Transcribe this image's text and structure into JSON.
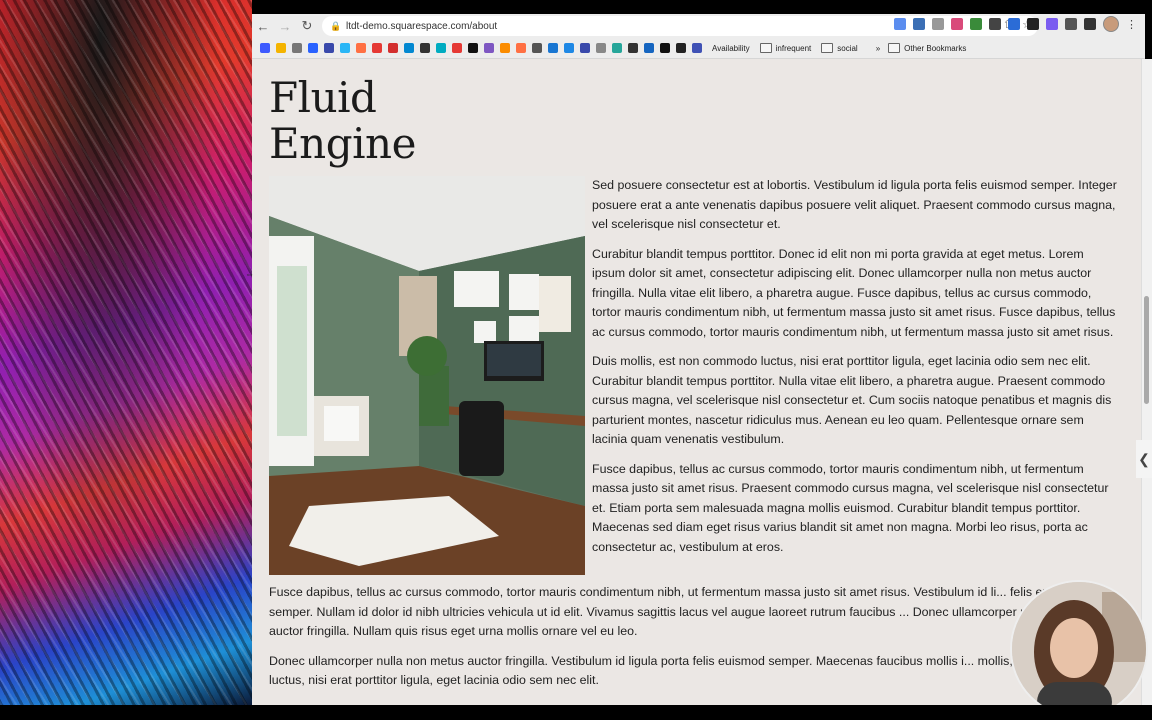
{
  "browser": {
    "url": "ltdt-demo.squarespace.com/about",
    "bookmarks": [
      {
        "label": "Availability"
      },
      {
        "label": "infrequent"
      },
      {
        "label": "social"
      },
      {
        "label": "Other Bookmarks"
      }
    ],
    "more_bookmarks": "»"
  },
  "page": {
    "heading_line1": "Fluid",
    "heading_line2": "Engine",
    "column_paragraphs": [
      "Sed posuere consectetur est at lobortis. Vestibulum id ligula porta felis euismod semper. Integer posuere erat a ante venenatis dapibus posuere velit aliquet. Praesent commodo cursus magna, vel scelerisque nisl consectetur et.",
      "Curabitur blandit tempus porttitor. Donec id elit non mi porta gravida at eget metus. Lorem ipsum dolor sit amet, consectetur adipiscing elit. Donec ullamcorper nulla non metus auctor fringilla. Nulla vitae elit libero, a pharetra augue. Fusce dapibus, tellus ac cursus commodo, tortor mauris condimentum nibh, ut fermentum massa justo sit amet risus. Fusce dapibus, tellus ac cursus commodo, tortor mauris condimentum nibh, ut fermentum massa justo sit amet risus.",
      "Duis mollis, est non commodo luctus, nisi erat porttitor ligula, eget lacinia odio sem nec elit. Curabitur blandit tempus porttitor. Nulla vitae elit libero, a pharetra augue. Praesent commodo cursus magna, vel scelerisque nisl consectetur et. Cum sociis natoque penatibus et magnis dis parturient montes, nascetur ridiculus mus. Aenean eu leo quam. Pellentesque ornare sem lacinia quam venenatis vestibulum.",
      "Fusce dapibus, tellus ac cursus commodo, tortor mauris condimentum nibh, ut fermentum massa justo sit amet risus. Praesent commodo cursus magna, vel scelerisque nisl consectetur et. Etiam porta sem malesuada magna mollis euismod. Curabitur blandit tempus porttitor. Maecenas sed diam eget risus varius blandit sit amet non magna. Morbi leo risus, porta ac consectetur ac, vestibulum at eros."
    ],
    "full_paragraphs": [
      "Fusce dapibus, tellus ac cursus commodo, tortor mauris condimentum nibh, ut fermentum massa justo sit amet risus. Vestibulum id li... felis euismod semper. Nullam id dolor id nibh ultricies vehicula ut id elit. Vivamus sagittis lacus vel augue laoreet rutrum faucibus ... Donec ullamcorper nulla non metus auctor fringilla. Nullam quis risus eget urna mollis ornare vel eu leo.",
      "Donec ullamcorper nulla non metus auctor fringilla. Vestibulum id ligula porta felis euismod semper. Maecenas faucibus mollis i... mollis, est non commodo luctus, nisi erat porttitor ligula, eget lacinia odio sem nec elit."
    ]
  },
  "icons": {
    "back": "back-arrow-icon",
    "forward": "forward-arrow-icon",
    "reload": "reload-icon",
    "side_tab": "chevron-left-icon"
  },
  "colors": {
    "page_bg": "#ebe7e4",
    "text": "#222222",
    "chrome_bg": "#ededed"
  }
}
